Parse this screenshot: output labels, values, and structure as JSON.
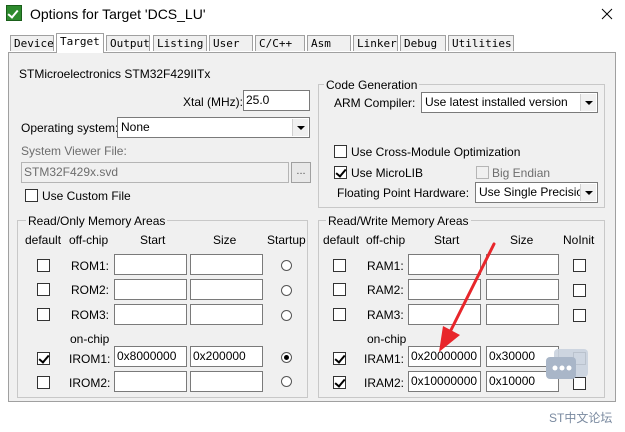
{
  "window": {
    "title": "Options for Target 'DCS_LU'"
  },
  "tabs": [
    {
      "label": "Device",
      "active": false
    },
    {
      "label": "Target",
      "active": true
    },
    {
      "label": "Output",
      "active": false
    },
    {
      "label": "Listing",
      "active": false
    },
    {
      "label": "User",
      "active": false
    },
    {
      "label": "C/C++",
      "active": false
    },
    {
      "label": "Asm",
      "active": false
    },
    {
      "label": "Linker",
      "active": false
    },
    {
      "label": "Debug",
      "active": false
    },
    {
      "label": "Utilities",
      "active": false
    }
  ],
  "device_name": "STMicroelectronics STM32F429IITx",
  "xtal": {
    "label": "Xtal (MHz):",
    "value": "25.0"
  },
  "os": {
    "label": "Operating system:",
    "value": "None"
  },
  "svd": {
    "label": "System Viewer File:",
    "value": "STM32F429x.svd",
    "browse": "...",
    "custom_label": "Use Custom File",
    "custom_checked": false
  },
  "codegen": {
    "title": "Code Generation",
    "compiler_label": "ARM Compiler:",
    "compiler_value": "Use latest installed version",
    "cross_module_label": "Use Cross-Module Optimization",
    "cross_module_checked": false,
    "microlib_label": "Use MicroLIB",
    "microlib_checked": true,
    "big_endian_label": "Big Endian",
    "big_endian_checked": false,
    "fp_label": "Floating Point Hardware:",
    "fp_value": "Use Single Precision"
  },
  "ro": {
    "title": "Read/Only Memory Areas",
    "col_default": "default",
    "col_offchip": "off-chip",
    "col_start": "Start",
    "col_size": "Size",
    "col_startup": "Startup",
    "onchip_label": "on-chip",
    "rows": [
      {
        "name": "ROM1:",
        "default": false,
        "start": "",
        "size": "",
        "startup": false
      },
      {
        "name": "ROM2:",
        "default": false,
        "start": "",
        "size": "",
        "startup": false
      },
      {
        "name": "ROM3:",
        "default": false,
        "start": "",
        "size": "",
        "startup": false
      },
      {
        "name": "IROM1:",
        "default": true,
        "start": "0x8000000",
        "size": "0x200000",
        "startup": true
      },
      {
        "name": "IROM2:",
        "default": false,
        "start": "",
        "size": "",
        "startup": false
      }
    ]
  },
  "rw": {
    "title": "Read/Write Memory Areas",
    "col_default": "default",
    "col_offchip": "off-chip",
    "col_start": "Start",
    "col_size": "Size",
    "col_noinit": "NoInit",
    "onchip_label": "on-chip",
    "rows": [
      {
        "name": "RAM1:",
        "default": false,
        "start": "",
        "size": "",
        "noinit": false
      },
      {
        "name": "RAM2:",
        "default": false,
        "start": "",
        "size": "",
        "noinit": false
      },
      {
        "name": "RAM3:",
        "default": false,
        "start": "",
        "size": "",
        "noinit": false
      },
      {
        "name": "IRAM1:",
        "default": true,
        "start": "0x20000000",
        "size": "0x30000",
        "noinit": false
      },
      {
        "name": "IRAM2:",
        "default": true,
        "start": "0x10000000",
        "size": "0x10000",
        "noinit": false
      }
    ]
  },
  "watermark": {
    "text": "ST中文论坛"
  },
  "colors": {
    "annotation_arrow": "#e8262b",
    "panel_bg": "#f0f0f0",
    "watermark": "#7a8aa0"
  }
}
